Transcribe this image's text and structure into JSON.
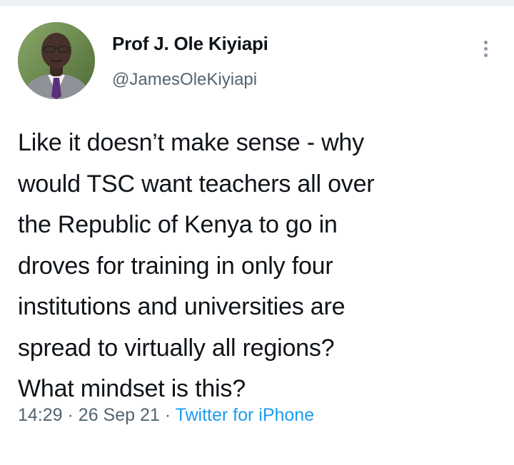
{
  "author": {
    "name": "Prof J. Ole Kiyiapi",
    "handle": "@JamesOleKiyiapi",
    "avatar_icon": "profile-photo-icon"
  },
  "tweet": {
    "text_lines": [
      "Like it doesn’t make sense - why",
      "would TSC want teachers all over",
      "the Republic of Kenya to go in",
      "droves for training in only four",
      "institutions and universities are",
      "spread to virtually all regions?",
      "What mindset is this?"
    ]
  },
  "meta": {
    "time": "14:29",
    "separator": "·",
    "date": "26 Sep 21",
    "source": "Twitter for iPhone"
  },
  "icons": {
    "more": "more-options-icon"
  },
  "colors": {
    "text": "#0f1419",
    "secondary": "#536471",
    "link": "#1d9bf0"
  }
}
